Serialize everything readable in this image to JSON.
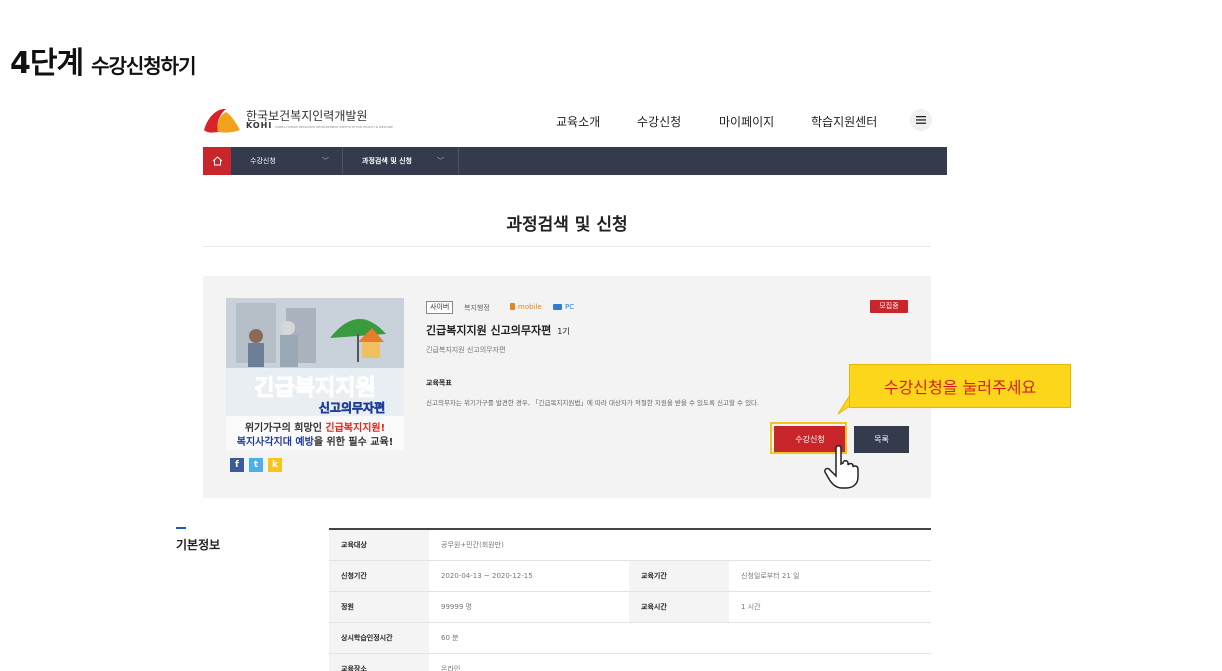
{
  "guide": {
    "step": "4단계",
    "title": "수강신청하기"
  },
  "header": {
    "logo_kr": "한국보건복지인력개발원",
    "logo_en": "KOHI",
    "logo_en_small": "KOREA HUMAN RESOURCE DEVELOPMENT INSTITUTE FOR HEALTH & WELFARE",
    "nav": [
      "교육소개",
      "수강신청",
      "마이페이지",
      "학습지원센터"
    ],
    "menu_icon": "hamburger-icon"
  },
  "subnav": {
    "home_icon": "home-icon",
    "item1": "수강신청",
    "item2": "과정검색 및 신청",
    "chevron": "﹀"
  },
  "page": {
    "title": "과정검색 및 신청"
  },
  "course": {
    "thumb_line1": "긴급복지지원",
    "thumb_line2": "신고의무자편",
    "thumb_line3a": "위기가구의 희망인 ",
    "thumb_line3b": "긴급복지지원!",
    "thumb_line4a": "복지사각지대 예방",
    "thumb_line4b": "을 위한 필수 교육!",
    "share": [
      "f",
      "t",
      "k"
    ],
    "tag_cyber": "사이버",
    "category": "복지행정",
    "tag_mobile": "mobile",
    "tag_pc": "PC",
    "status": "모집중",
    "name": "긴급복지지원 신고의무자편",
    "term": "1기",
    "subtitle": "긴급복지지원 신고의무자편",
    "goal_heading": "교육목표",
    "goal_text": "신고의무자는 위기가구를 발견한 경우, 「긴급복지지원법」에 따라 대상자가 적절한 지원을 받을 수 있도록 신고할 수 있다.",
    "apply_label": "수강신청",
    "list_label": "목록"
  },
  "callout": {
    "text": "수강신청을 눌러주세요"
  },
  "info": {
    "title": "기본정보",
    "rows": [
      {
        "k1": "교육대상",
        "v1": "공무원+민간(회원만)"
      },
      {
        "k1": "신청기간",
        "v1": "2020-04-13 ~ 2020-12-15",
        "k2": "교육기간",
        "v2": "신청일로부터 21 일"
      },
      {
        "k1": "정원",
        "v1": "99999 명",
        "k2": "교육시간",
        "v2": "1 시간"
      },
      {
        "k1": "상시학습인정시간",
        "v1": "60 분"
      },
      {
        "k1": "교육장소",
        "v1": "온라인"
      }
    ]
  },
  "colors": {
    "accent": "#c8262b",
    "nav": "#333b4c",
    "callout": "#fbd61b"
  }
}
